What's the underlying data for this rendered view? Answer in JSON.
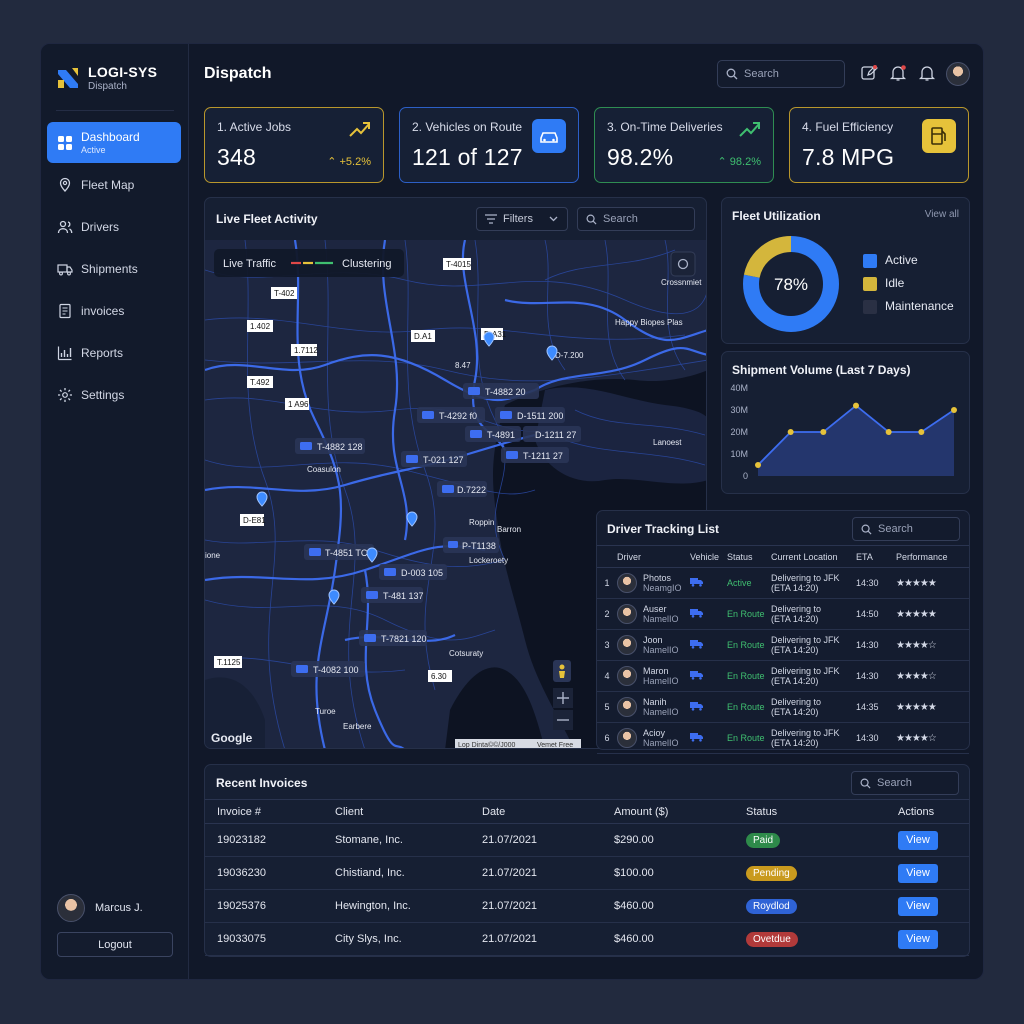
{
  "brand": {
    "name": "LOGI-SYS",
    "sub": "Dispatch"
  },
  "sidebar": {
    "items": [
      {
        "label": "Dashboard",
        "sub": "Active",
        "icon": "grid-icon"
      },
      {
        "label": "Fleet Map",
        "icon": "map-pin-icon"
      },
      {
        "label": "Drivers",
        "icon": "users-icon"
      },
      {
        "label": "Shipments",
        "icon": "truck-icon"
      },
      {
        "label": "invoices",
        "icon": "document-icon"
      },
      {
        "label": "Reports",
        "icon": "bar-chart-icon"
      },
      {
        "label": "Settings",
        "icon": "gear-icon"
      }
    ],
    "user": "Marcus J.",
    "logout": "Logout"
  },
  "header": {
    "title": "Dispatch",
    "search_placeholder": "Search"
  },
  "kpis": [
    {
      "title": "1. Active Jobs",
      "value": "348",
      "delta": "+5.2%",
      "color": "#e6c23a",
      "icon": "trend-up-icon"
    },
    {
      "title": "2. Vehicles on Route",
      "value": "121 of 127",
      "color": "#2f7bf5",
      "icon": "car-icon"
    },
    {
      "title": "3. On-Time Deliveries",
      "value": "98.2%",
      "delta": "98.2%",
      "color": "#3fbf70",
      "icon": "trend-up-icon"
    },
    {
      "title": "4. Fuel Efficiency",
      "value": "7.8 MPG",
      "color": "#e6c23a",
      "icon": "fuel-icon"
    }
  ],
  "map": {
    "title": "Live Fleet Activity",
    "filters": "Filters",
    "search_placeholder": "Search",
    "legend_traffic": "Live Traffic",
    "legend_cluster": "Clustering",
    "google": "Google",
    "attribution1": "Lop Dinta©©/J000",
    "attribution2": "Vemet Free",
    "vehicles": [
      "T-4882 20",
      "T-4292 f0",
      "D-1511 200",
      "T-4891",
      "D-1211 27",
      "T-4882 128",
      "T-021 127",
      "T-1211 27",
      "T-4851 TC7",
      "D-003 105",
      "T-481 137",
      "T-7821 120",
      "T-4082 100",
      "D.7222",
      "P-T1138"
    ],
    "places": [
      "T-4015",
      "T-402",
      "Crossnmiet",
      "1.402",
      "D.A1",
      "1.7112",
      "T.492",
      "1 A96",
      "D.A31",
      "Happy Biopes Plas",
      "8.47",
      "D-7.200",
      "Lanoest",
      "Coasulon",
      "Roppin",
      "Barron",
      "Lockeroety",
      "D-E81",
      "ione",
      "Cotsuraty",
      "T.1125",
      "6.30",
      "Turoe",
      "Earbere"
    ]
  },
  "utilization": {
    "title": "Fleet Utilization",
    "link": "View all",
    "center": "78%",
    "legend": [
      {
        "label": "Active",
        "color": "#2f7bf5",
        "value": 78
      },
      {
        "label": "Idle",
        "color": "#d4b63c",
        "value": 22
      },
      {
        "label": "Maintenance",
        "color": "#2a3044",
        "value": 0
      }
    ]
  },
  "volume": {
    "title": "Shipment Volume (Last 7 Days)"
  },
  "chart_data": {
    "type": "area",
    "title": "Shipment Volume (Last 7 Days)",
    "y_ticks": [
      "0",
      "10M",
      "20M",
      "30M",
      "40M"
    ],
    "ylim": [
      0,
      40
    ],
    "values": [
      5,
      20,
      20,
      32,
      20,
      20,
      30
    ]
  },
  "drivers": {
    "title": "Driver Tracking List",
    "search_placeholder": "Search",
    "headers": [
      "Driver",
      "Vehicle",
      "Status",
      "Current Location",
      "ETA",
      "Performance"
    ],
    "rows": [
      {
        "n": "1",
        "name": "Photos",
        "sub": "NeamgIO",
        "status": "Active",
        "loc1": "Delivering to JFK",
        "loc2": "(ETA 14:20)",
        "eta": "14:30",
        "stars": "★★★★★"
      },
      {
        "n": "2",
        "name": "Auser",
        "sub": "NamelIO",
        "status": "En Route",
        "loc1": "Delivering to",
        "loc2": "(ETA 14:20)",
        "eta": "14:50",
        "stars": "★★★★★"
      },
      {
        "n": "3",
        "name": "Joon",
        "sub": "NamelIO",
        "status": "En Route",
        "loc1": "Delivering to JFK",
        "loc2": "(ETA 14:20)",
        "eta": "14:30",
        "stars": "★★★★☆"
      },
      {
        "n": "4",
        "name": "Maron",
        "sub": "HamelIO",
        "status": "En Route",
        "loc1": "Delivering to JFK",
        "loc2": "(ETA 14:20)",
        "eta": "14:30",
        "stars": "★★★★☆"
      },
      {
        "n": "5",
        "name": "Nanih",
        "sub": "NamelIO",
        "status": "En Route",
        "loc1": "Delivering to",
        "loc2": "(ETA 14:20)",
        "eta": "14:35",
        "stars": "★★★★★"
      },
      {
        "n": "6",
        "name": "Acioy",
        "sub": "NamelIO",
        "status": "En Route",
        "loc1": "Delivering to JFK",
        "loc2": "(ETA 14:20)",
        "eta": "14:30",
        "stars": "★★★★☆"
      }
    ]
  },
  "invoices": {
    "title": "Recent Invoices",
    "search_placeholder": "Search",
    "headers": [
      "Invoice #",
      "Client",
      "Date",
      "Amount ($)",
      "Status",
      "Actions"
    ],
    "rows": [
      {
        "id": "19023182",
        "client": "Stomane, Inc.",
        "date": "21.07/2021",
        "amount": "$290.00",
        "status": "Paid",
        "color": "#2e8a4a",
        "action": "View"
      },
      {
        "id": "19036230",
        "client": "Chistiand, Inc.",
        "date": "21.07/2021",
        "amount": "$100.00",
        "status": "Pending",
        "color": "#c99a1e",
        "action": "View"
      },
      {
        "id": "19025376",
        "client": "Hewington, Inc.",
        "date": "21.07/2021",
        "amount": "$460.00",
        "status": "Roydlod",
        "color": "#2f63d6",
        "action": "View"
      },
      {
        "id": "19033075",
        "client": "City Slys, Inc.",
        "date": "21.07/2021",
        "amount": "$460.00",
        "status": "Ovetdue",
        "color": "#b13a3a",
        "action": "View"
      }
    ]
  }
}
